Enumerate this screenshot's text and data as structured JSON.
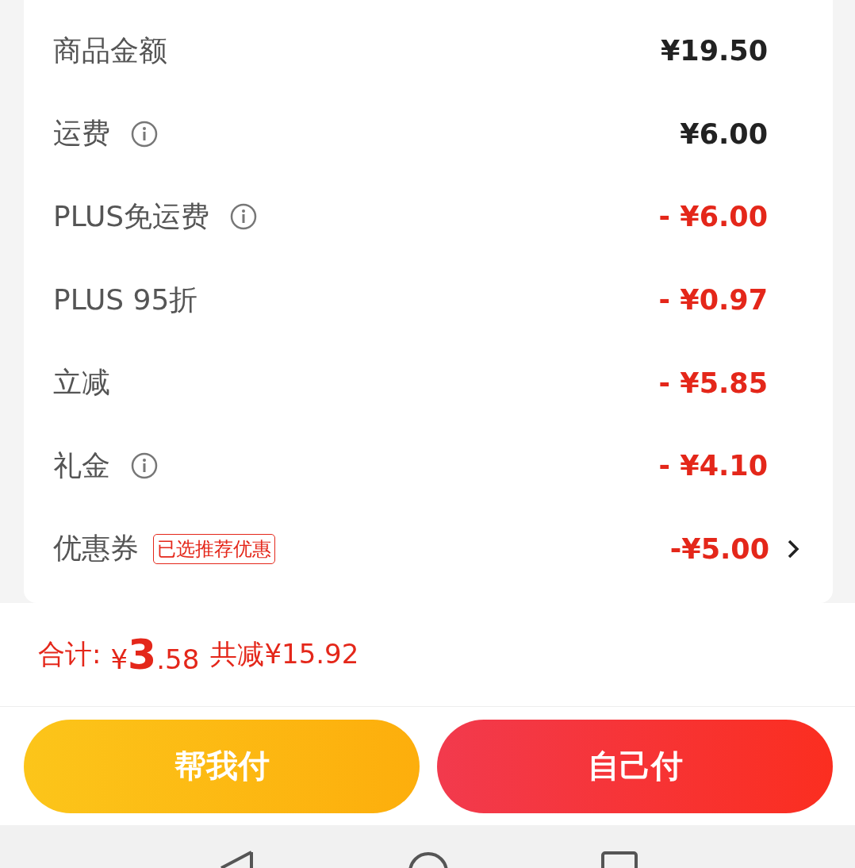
{
  "rows": [
    {
      "kind": "amount",
      "label": "商品金额",
      "info": false,
      "value": "¥19.50"
    },
    {
      "kind": "amount",
      "label": "运费",
      "info": true,
      "value": "¥6.00"
    },
    {
      "kind": "discount",
      "label": "PLUS免运费",
      "info": true,
      "value": "- ¥6.00"
    },
    {
      "kind": "discount",
      "label": "PLUS 95折",
      "info": false,
      "value": "- ¥0.97"
    },
    {
      "kind": "discount",
      "label": "立减",
      "info": false,
      "value": "- ¥5.85"
    },
    {
      "kind": "discount",
      "label": "礼金",
      "info": true,
      "value": "- ¥4.10"
    },
    {
      "kind": "coupon",
      "label": "优惠券",
      "info": false,
      "tag": "已选推荐优惠",
      "value": "-¥5.00"
    }
  ],
  "total": {
    "label": "合计:",
    "currency": "¥",
    "integer": "3",
    "decimal": ".58",
    "savings": "共减¥15.92"
  },
  "buttons": [
    {
      "kind": "secondary",
      "label": "帮我付"
    },
    {
      "kind": "primary",
      "label": "自己付"
    }
  ]
}
